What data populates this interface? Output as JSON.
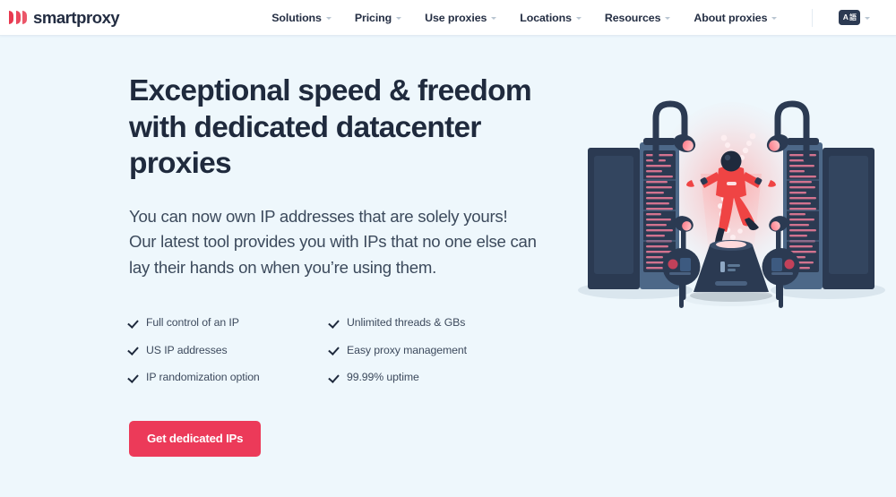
{
  "brand": {
    "name": "smartproxy",
    "logo_icon": "smartproxy-chevrons-icon",
    "accent_color": "#e8384f"
  },
  "nav": {
    "items": [
      {
        "label": "Solutions",
        "has_dropdown": true
      },
      {
        "label": "Pricing",
        "has_dropdown": true
      },
      {
        "label": "Use proxies",
        "has_dropdown": true
      },
      {
        "label": "Locations",
        "has_dropdown": true
      },
      {
        "label": "Resources",
        "has_dropdown": true
      },
      {
        "label": "About proxies",
        "has_dropdown": true
      }
    ],
    "language": {
      "icon": "translate-icon",
      "latin_glyph": "A",
      "cjk_glyph": "語",
      "has_dropdown": true
    }
  },
  "hero": {
    "headline": "Exceptional speed & freedom with dedicated datacenter proxies",
    "subcopy": "You can now own IP addresses that are solely yours! Our latest tool provides you with IPs that no one else can lay their hands on when you’re using them.",
    "features": [
      "Full control of an IP",
      "Unlimited threads & GBs",
      "US IP addresses",
      "Easy proxy management",
      "IP randomization option",
      "99.99% uptime"
    ],
    "cta_label": "Get dedicated IPs",
    "cta_color": "#ec3a59",
    "illustration": "datacenter-servers-astronaut-illustration"
  },
  "colors": {
    "page_background": "#eef7fc",
    "navbar_background": "#ffffff",
    "heading_text": "#1f2a3d",
    "body_text": "#3c4a5c",
    "server_dark": "#26344a",
    "server_light": "#4a6380",
    "figure_red": "#ef4444"
  }
}
